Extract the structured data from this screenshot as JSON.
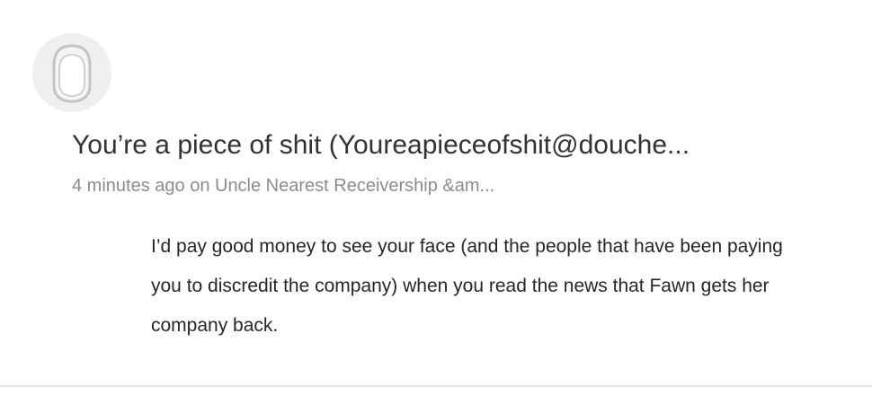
{
  "comment": {
    "avatar_icon": "default-user-avatar-icon",
    "author": "You’re a piece of shit (Youreapieceofshit@douche...",
    "meta": "4 minutes ago on Uncle Nearest Receivership &am...",
    "body": "I’d pay good money to see your face (and the people that have been paying you to discredit the company) when you read the news that Fawn gets her company back."
  },
  "colors": {
    "author_text": "#333333",
    "meta_text": "#8c8c8c",
    "body_text": "#262626",
    "avatar_bg": "#efefef",
    "divider": "#e6e6e6"
  }
}
